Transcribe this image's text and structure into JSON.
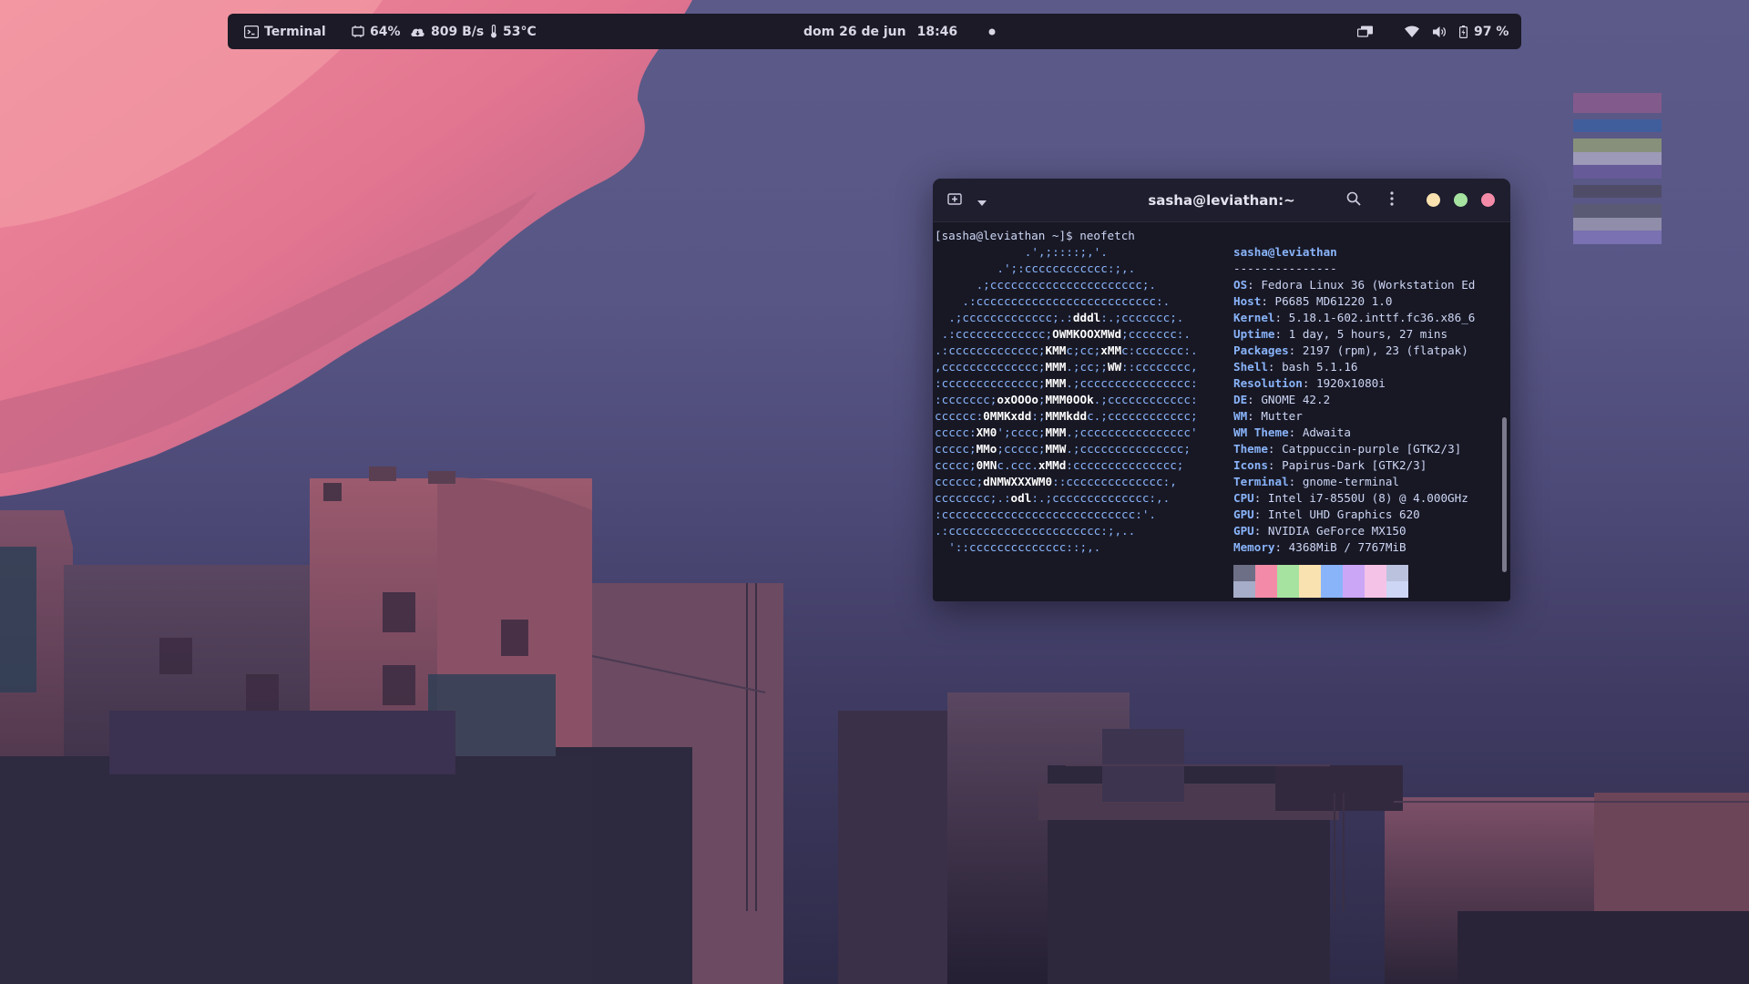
{
  "topbar": {
    "app_name": "Terminal",
    "app_icon": "terminal-icon",
    "cpu": "64%",
    "net": "809 B/s",
    "temp": "53°C",
    "date": "dom 26 de jun",
    "time": "18:46",
    "battery": "97 %",
    "icons": [
      "cpu-chip-icon",
      "cloud-download-icon",
      "thermometer-icon",
      "record-dot-icon",
      "screen-share-icon",
      "wifi-icon",
      "volume-icon",
      "battery-icon"
    ]
  },
  "workspaces": {
    "colors": [
      "#8b5b8d",
      "#3d5fa0",
      "#8f9a78",
      "#a9a4c1",
      "#6a5b9b",
      "#4d4a63",
      "#5c5a72",
      "#9a97b0",
      "#7f75b8"
    ]
  },
  "terminal": {
    "title": "sasha@leviathan:~",
    "prompt": "[sasha@leviathan ~]$ neofetch",
    "logo_lines": [
      "             .',;::::;,'.",
      "         .';:cccccccccccc:;,.",
      "      .;cccccccccccccccccccccc;.",
      "    .:cccccccccccccccccccccccccc:.",
      "  .;ccccccccccccc;.:dddl:.;ccccccc;.",
      " .:ccccccccccccc;OWMKOOXMWd;ccccccc:.",
      ".:ccccccccccccc;KMMc;cc;xMMc:ccccccc:.",
      ",cccccccccccccc;MMM.;cc;;WW::cccccccc,",
      ":cccccccccccccc;MMM.;cccccccccccccccc:",
      ":ccccccc;oxOOOo;MMM0OOk.;cccccccccccc:",
      "cccccc:0MMKxdd:;MMMkddc.;cccccccccccc;",
      "ccccc:XM0';cccc;MMM.;cccccccccccccccc'",
      "ccccc;MMo;ccccc;MMW.;ccccccccccccccc;",
      "ccccc;0MNc.ccc.xMMd:ccccccccccccccc;",
      "cccccc;dNMWXXXWM0::cccccccccccccc:,",
      "cccccccc;.:odl:.;cccccccccccccc:,.",
      ":cccccccccccccccccccccccccccc:'.",
      ".:cccccccccccccccccccccc:;,..",
      "  '::cccccccccccccc::;,."
    ],
    "user_host": "sasha@leviathan",
    "separator": "---------------",
    "info": [
      {
        "key": "OS",
        "value": "Fedora Linux 36 (Workstation Ed"
      },
      {
        "key": "Host",
        "value": "P6685 MD61220 1.0"
      },
      {
        "key": "Kernel",
        "value": "5.18.1-602.inttf.fc36.x86_6"
      },
      {
        "key": "Uptime",
        "value": "1 day, 5 hours, 27 mins"
      },
      {
        "key": "Packages",
        "value": "2197 (rpm), 23 (flatpak)"
      },
      {
        "key": "Shell",
        "value": "bash 5.1.16"
      },
      {
        "key": "Resolution",
        "value": "1920x1080i"
      },
      {
        "key": "DE",
        "value": "GNOME 42.2"
      },
      {
        "key": "WM",
        "value": "Mutter"
      },
      {
        "key": "WM Theme",
        "value": "Adwaita"
      },
      {
        "key": "Theme",
        "value": "Catppuccin-purple [GTK2/3]"
      },
      {
        "key": "Icons",
        "value": "Papirus-Dark [GTK2/3]"
      },
      {
        "key": "Terminal",
        "value": "gnome-terminal"
      },
      {
        "key": "CPU",
        "value": "Intel i7-8550U (8) @ 4.000GHz"
      },
      {
        "key": "GPU",
        "value": "Intel UHD Graphics 620"
      },
      {
        "key": "GPU",
        "value": "NVIDIA GeForce MX150"
      },
      {
        "key": "Memory",
        "value": "4368MiB / 7767MiB"
      }
    ],
    "palette_top": [
      "#6c6f85",
      "#f38ba8",
      "#a6e3a1",
      "#f9e2af",
      "#89b4fa",
      "#cba6f7",
      "#f5c2e7",
      "#bac2de"
    ],
    "palette_bottom": [
      "#a6adc8",
      "#f38ba8",
      "#a6e3a1",
      "#f9e2af",
      "#89b4fa",
      "#cba6f7",
      "#f5c2e7",
      "#cdd6f4"
    ],
    "window_controls": {
      "minimize": "#f9e2af",
      "maximize": "#a6e3a1",
      "close": "#f38ba8"
    }
  }
}
